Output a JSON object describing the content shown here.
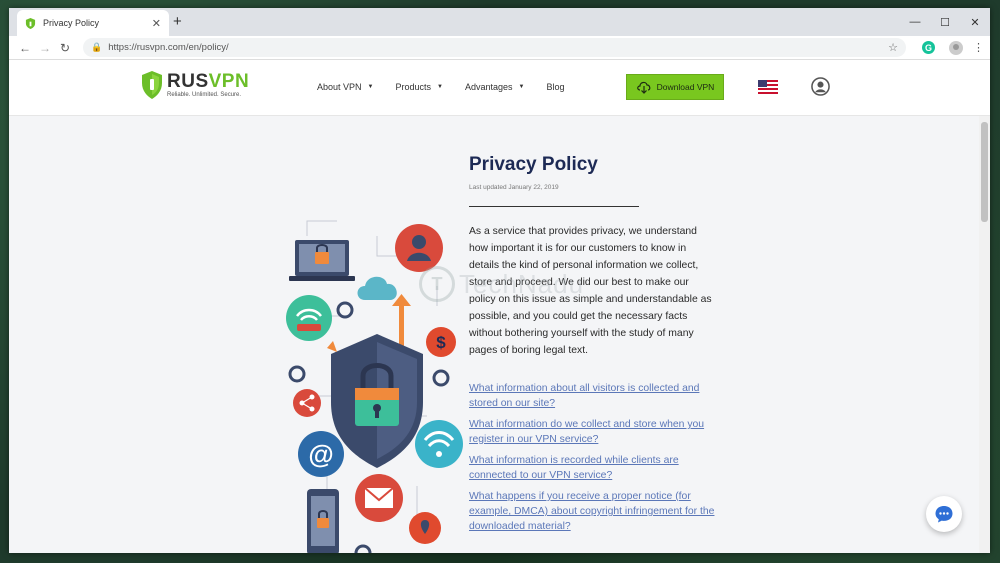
{
  "browser": {
    "tab_title": "Privacy Policy",
    "tab_close": "✕",
    "new_tab": "+",
    "url": "https://rusvpn.com/en/policy/",
    "controls": {
      "minimize": "—",
      "maximize": "☐",
      "close": "✕"
    },
    "extension_letter": "G"
  },
  "site": {
    "logo_name_a": "RUS",
    "logo_name_b": "VPN",
    "logo_tagline": "Reliable. Unlimited. Secure.",
    "nav": [
      {
        "label": "About VPN",
        "caret": "▼"
      },
      {
        "label": "Products",
        "caret": "▼"
      },
      {
        "label": "Advantages",
        "caret": "▼"
      },
      {
        "label": "Blog"
      }
    ],
    "download_label": "Download VPN",
    "colors": {
      "brand_green": "#79c71f",
      "title_navy": "#1d2a55",
      "link_blue": "#5b77b8"
    }
  },
  "page": {
    "title": "Privacy Policy",
    "updated": "Last updated January 22, 2019",
    "intro": "As a service that provides privacy, we understand how important it is for our customers to know in details the kind of personal information we collect, store and proceed. We did our best to make our policy on this issue as simple and understandable as possible, and you could get the necessary facts without bothering yourself with the study of many pages of boring legal text.",
    "links": [
      "What information about all visitors is collected and stored on our site?",
      "What information do we collect and store when you register in our VPN service?",
      "What information is recorded while clients are connected to our VPN service?",
      "What happens if you receive a proper notice (for example, DMCA) about copyright infringement for the downloaded material?"
    ]
  },
  "watermark": {
    "letter": "T",
    "text": "TechNadu"
  }
}
